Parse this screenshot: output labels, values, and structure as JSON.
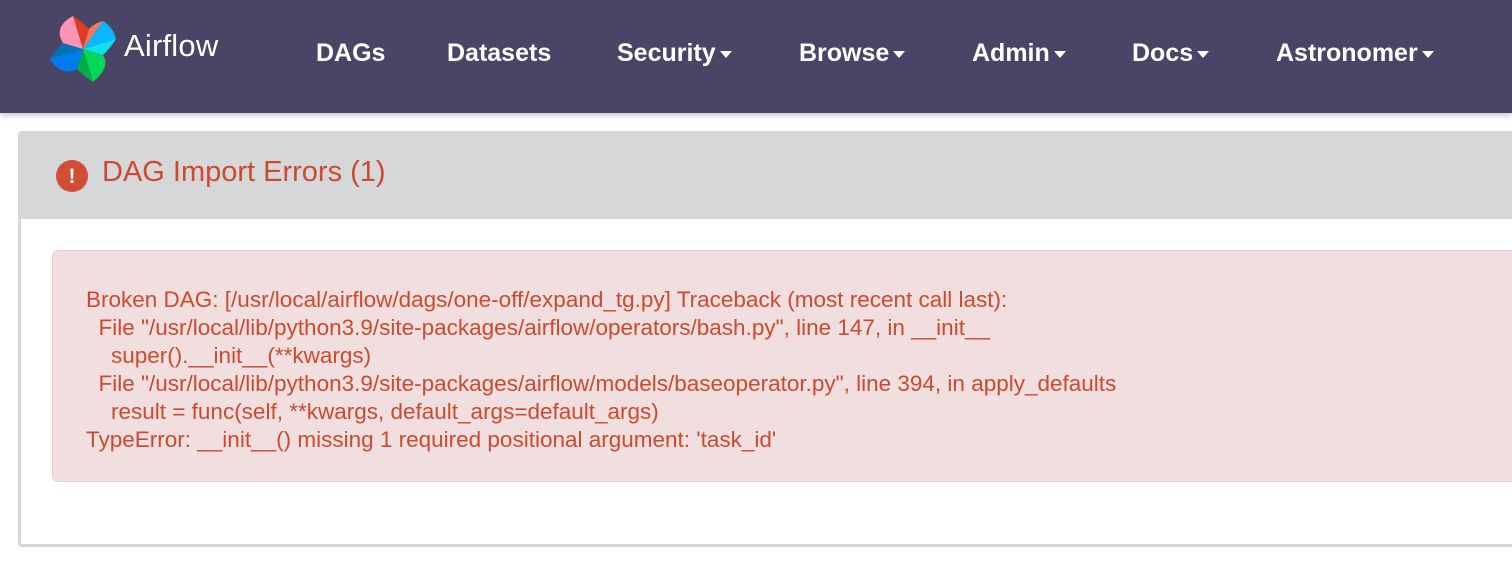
{
  "navbar": {
    "brand_name": "Airflow",
    "items": [
      {
        "label": "DAGs",
        "dropdown": false
      },
      {
        "label": "Datasets",
        "dropdown": false
      },
      {
        "label": "Security",
        "dropdown": true
      },
      {
        "label": "Browse",
        "dropdown": true
      },
      {
        "label": "Admin",
        "dropdown": true
      },
      {
        "label": "Docs",
        "dropdown": true
      },
      {
        "label": "Astronomer",
        "dropdown": true
      }
    ]
  },
  "import_errors": {
    "icon": "exclamation-circle-icon",
    "title": "DAG Import Errors (1)",
    "message_lines": [
      "Broken DAG: [/usr/local/airflow/dags/one-off/expand_tg.py] Traceback (most recent call last):",
      "  File \"/usr/local/lib/python3.9/site-packages/airflow/operators/bash.py\", line 147, in __init__",
      "    super().__init__(**kwargs)",
      "  File \"/usr/local/lib/python3.9/site-packages/airflow/models/baseoperator.py\", line 394, in apply_defaults",
      "    result = func(self, **kwargs, default_args=default_args)",
      "TypeError: __init__() missing 1 required positional argument: 'task_id'"
    ]
  },
  "colors": {
    "navbar_bg": "#4a4566",
    "error_text": "#cd4a2e",
    "error_bg": "#f1dedf",
    "panel_heading_bg": "#d6d7d8"
  }
}
